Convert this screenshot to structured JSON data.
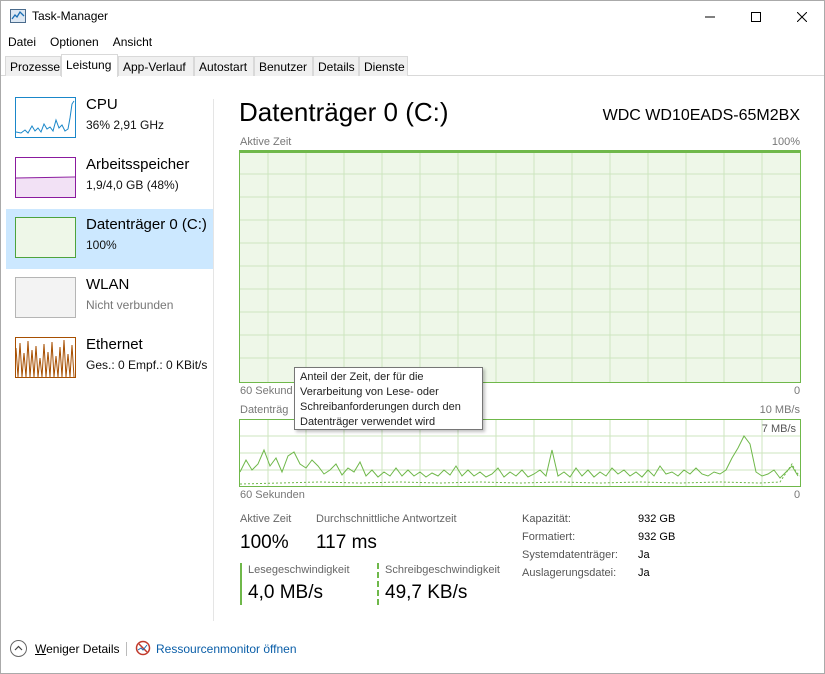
{
  "window": {
    "title": "Task-Manager",
    "controls": {
      "minimize": "minimize-icon",
      "maximize": "maximize-icon",
      "close": "close-icon"
    }
  },
  "menu": [
    "Datei",
    "Optionen",
    "Ansicht"
  ],
  "tabs": [
    "Prozesse",
    "Leistung",
    "App-Verlauf",
    "Autostart",
    "Benutzer",
    "Details",
    "Dienste"
  ],
  "active_tab": "Leistung",
  "resources": [
    {
      "name": "CPU",
      "sub": "36% 2,91 GHz",
      "color": "#1a87c9"
    },
    {
      "name": "Arbeitsspeicher",
      "sub": "1,9/4,0 GB (48%)",
      "color": "#8b1a9e"
    },
    {
      "name": "Datenträger 0 (C:)",
      "sub": "100%",
      "color": "#4da33c",
      "selected": true
    },
    {
      "name": "WLAN",
      "sub": "Nicht verbunden",
      "color": "#a0a0a0"
    },
    {
      "name": "Ethernet",
      "sub": "Ges.: 0 Empf.: 0 KBit/s",
      "color": "#a74f01"
    }
  ],
  "detail": {
    "title": "Datenträger 0 (C:)",
    "model": "WDC WD10EADS-65M2BX",
    "graph1": {
      "label": "Aktive Zeit",
      "max": "100%",
      "time": "60 Sekund",
      "min": "0"
    },
    "graph2": {
      "label": "Datenträg",
      "max": "10 MB/s",
      "inner_max": "7 MB/s",
      "time": "60 Sekunden",
      "min": "0"
    },
    "tooltip": "Anteil der Zeit, der für die Verarbeitung von Lese- oder Schreibanforderungen durch den Datenträger verwendet wird",
    "stats": {
      "active_time_label": "Aktive Zeit",
      "active_time_value": "100%",
      "response_label": "Durchschnittliche Antwortzeit",
      "response_value": "117 ms",
      "read_label": "Lesegeschwindigkeit",
      "read_value": "4,0 MB/s",
      "write_label": "Schreibgeschwindigkeit",
      "write_value": "49,7 KB/s"
    },
    "properties": [
      {
        "label": "Kapazität:",
        "value": "932 GB"
      },
      {
        "label": "Formatiert:",
        "value": "932 GB"
      },
      {
        "label": "Systemdatenträger:",
        "value": "Ja"
      },
      {
        "label": "Auslagerungsdatei:",
        "value": "Ja"
      }
    ]
  },
  "footer": {
    "fewer_details": "Weniger Details",
    "resource_monitor": "Ressourcenmonitor öffnen"
  },
  "colors": {
    "disk_green": "#6fb84a",
    "selection": "#cce8ff",
    "link": "#0a5ea8"
  }
}
